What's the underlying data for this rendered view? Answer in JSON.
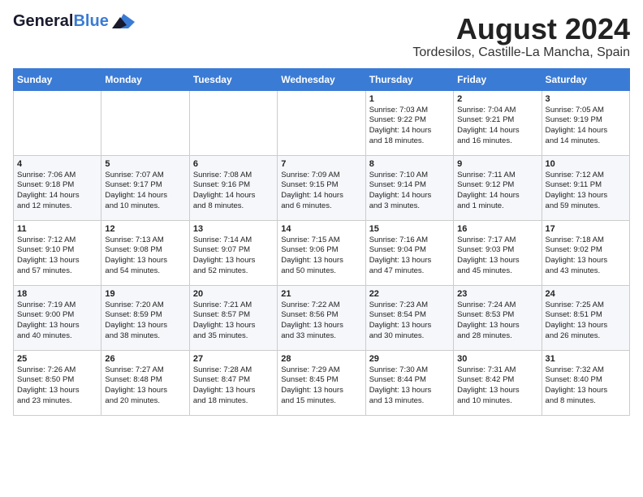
{
  "header": {
    "logo_general": "General",
    "logo_blue": "Blue",
    "month_title": "August 2024",
    "location": "Tordesilos, Castille-La Mancha, Spain"
  },
  "days_of_week": [
    "Sunday",
    "Monday",
    "Tuesday",
    "Wednesday",
    "Thursday",
    "Friday",
    "Saturday"
  ],
  "weeks": [
    [
      {
        "day": "",
        "info": ""
      },
      {
        "day": "",
        "info": ""
      },
      {
        "day": "",
        "info": ""
      },
      {
        "day": "",
        "info": ""
      },
      {
        "day": "1",
        "info": "Sunrise: 7:03 AM\nSunset: 9:22 PM\nDaylight: 14 hours\nand 18 minutes."
      },
      {
        "day": "2",
        "info": "Sunrise: 7:04 AM\nSunset: 9:21 PM\nDaylight: 14 hours\nand 16 minutes."
      },
      {
        "day": "3",
        "info": "Sunrise: 7:05 AM\nSunset: 9:19 PM\nDaylight: 14 hours\nand 14 minutes."
      }
    ],
    [
      {
        "day": "4",
        "info": "Sunrise: 7:06 AM\nSunset: 9:18 PM\nDaylight: 14 hours\nand 12 minutes."
      },
      {
        "day": "5",
        "info": "Sunrise: 7:07 AM\nSunset: 9:17 PM\nDaylight: 14 hours\nand 10 minutes."
      },
      {
        "day": "6",
        "info": "Sunrise: 7:08 AM\nSunset: 9:16 PM\nDaylight: 14 hours\nand 8 minutes."
      },
      {
        "day": "7",
        "info": "Sunrise: 7:09 AM\nSunset: 9:15 PM\nDaylight: 14 hours\nand 6 minutes."
      },
      {
        "day": "8",
        "info": "Sunrise: 7:10 AM\nSunset: 9:14 PM\nDaylight: 14 hours\nand 3 minutes."
      },
      {
        "day": "9",
        "info": "Sunrise: 7:11 AM\nSunset: 9:12 PM\nDaylight: 14 hours\nand 1 minute."
      },
      {
        "day": "10",
        "info": "Sunrise: 7:12 AM\nSunset: 9:11 PM\nDaylight: 13 hours\nand 59 minutes."
      }
    ],
    [
      {
        "day": "11",
        "info": "Sunrise: 7:12 AM\nSunset: 9:10 PM\nDaylight: 13 hours\nand 57 minutes."
      },
      {
        "day": "12",
        "info": "Sunrise: 7:13 AM\nSunset: 9:08 PM\nDaylight: 13 hours\nand 54 minutes."
      },
      {
        "day": "13",
        "info": "Sunrise: 7:14 AM\nSunset: 9:07 PM\nDaylight: 13 hours\nand 52 minutes."
      },
      {
        "day": "14",
        "info": "Sunrise: 7:15 AM\nSunset: 9:06 PM\nDaylight: 13 hours\nand 50 minutes."
      },
      {
        "day": "15",
        "info": "Sunrise: 7:16 AM\nSunset: 9:04 PM\nDaylight: 13 hours\nand 47 minutes."
      },
      {
        "day": "16",
        "info": "Sunrise: 7:17 AM\nSunset: 9:03 PM\nDaylight: 13 hours\nand 45 minutes."
      },
      {
        "day": "17",
        "info": "Sunrise: 7:18 AM\nSunset: 9:02 PM\nDaylight: 13 hours\nand 43 minutes."
      }
    ],
    [
      {
        "day": "18",
        "info": "Sunrise: 7:19 AM\nSunset: 9:00 PM\nDaylight: 13 hours\nand 40 minutes."
      },
      {
        "day": "19",
        "info": "Sunrise: 7:20 AM\nSunset: 8:59 PM\nDaylight: 13 hours\nand 38 minutes."
      },
      {
        "day": "20",
        "info": "Sunrise: 7:21 AM\nSunset: 8:57 PM\nDaylight: 13 hours\nand 35 minutes."
      },
      {
        "day": "21",
        "info": "Sunrise: 7:22 AM\nSunset: 8:56 PM\nDaylight: 13 hours\nand 33 minutes."
      },
      {
        "day": "22",
        "info": "Sunrise: 7:23 AM\nSunset: 8:54 PM\nDaylight: 13 hours\nand 30 minutes."
      },
      {
        "day": "23",
        "info": "Sunrise: 7:24 AM\nSunset: 8:53 PM\nDaylight: 13 hours\nand 28 minutes."
      },
      {
        "day": "24",
        "info": "Sunrise: 7:25 AM\nSunset: 8:51 PM\nDaylight: 13 hours\nand 26 minutes."
      }
    ],
    [
      {
        "day": "25",
        "info": "Sunrise: 7:26 AM\nSunset: 8:50 PM\nDaylight: 13 hours\nand 23 minutes."
      },
      {
        "day": "26",
        "info": "Sunrise: 7:27 AM\nSunset: 8:48 PM\nDaylight: 13 hours\nand 20 minutes."
      },
      {
        "day": "27",
        "info": "Sunrise: 7:28 AM\nSunset: 8:47 PM\nDaylight: 13 hours\nand 18 minutes."
      },
      {
        "day": "28",
        "info": "Sunrise: 7:29 AM\nSunset: 8:45 PM\nDaylight: 13 hours\nand 15 minutes."
      },
      {
        "day": "29",
        "info": "Sunrise: 7:30 AM\nSunset: 8:44 PM\nDaylight: 13 hours\nand 13 minutes."
      },
      {
        "day": "30",
        "info": "Sunrise: 7:31 AM\nSunset: 8:42 PM\nDaylight: 13 hours\nand 10 minutes."
      },
      {
        "day": "31",
        "info": "Sunrise: 7:32 AM\nSunset: 8:40 PM\nDaylight: 13 hours\nand 8 minutes."
      }
    ]
  ]
}
